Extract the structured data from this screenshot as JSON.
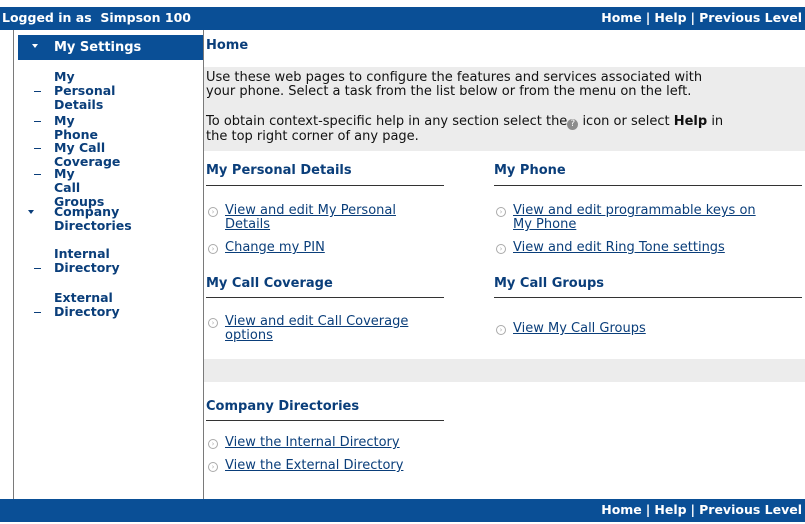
{
  "header": {
    "logged_in_label": "Logged in as",
    "user": "Simpson 100",
    "nav": {
      "home": "Home",
      "help": "Help",
      "previous": "Previous Level"
    }
  },
  "sidebar": {
    "selected": "My Settings",
    "items": [
      {
        "label_line1": "My Personal",
        "label_line2": "Details"
      },
      {
        "label_line1": "My Phone"
      },
      {
        "label_line1": "My Call Coverage"
      },
      {
        "label_line1": "My Call Groups"
      }
    ],
    "company": {
      "label_line1": "Company",
      "label_line2": "Directories"
    },
    "company_items": [
      {
        "label_line1": "Internal",
        "label_line2": "Directory"
      },
      {
        "label_line1": "External",
        "label_line2": "Directory"
      }
    ]
  },
  "main": {
    "title": "Home",
    "intro1_line1": "Use these web pages to configure the features and services associated with",
    "intro1_line2": "your phone. Select a task from the list below or from the menu on the left.",
    "intro2_line1_a": "To obtain context-specific help in any section select the",
    "intro2_line1_b": " icon or select ",
    "intro2_line1_help": "Help",
    "intro2_line1_c": " in",
    "intro2_line2": "the top right corner of any page.",
    "sections": {
      "personal": {
        "title": "My Personal Details",
        "links": [
          {
            "l1": "View and edit My Personal",
            "l2": "Details"
          },
          {
            "l1": "Change my PIN"
          }
        ]
      },
      "phone": {
        "title": "My Phone",
        "links": [
          {
            "l1": "View and edit programmable keys on",
            "l2": "My Phone"
          },
          {
            "l1": "View and edit Ring Tone settings"
          }
        ]
      },
      "coverage": {
        "title": "My Call Coverage",
        "links": [
          {
            "l1": "View and edit Call Coverage",
            "l2": "options"
          }
        ]
      },
      "groups": {
        "title": "My Call Groups",
        "links": [
          {
            "l1": "View My Call Groups"
          }
        ]
      },
      "directories": {
        "title": "Company Directories",
        "links": [
          {
            "l1": "View the Internal Directory"
          },
          {
            "l1": "View the External Directory"
          }
        ]
      }
    }
  },
  "footer": {
    "nav": {
      "home": "Home",
      "help": "Help",
      "previous": "Previous Level"
    }
  },
  "colors": {
    "brand": "#0a4f96",
    "band": "#ececec",
    "link": "#0a3e7a"
  },
  "icons": {
    "help": "help-circle-icon",
    "link_bullet": "circle-arrow-icon"
  }
}
